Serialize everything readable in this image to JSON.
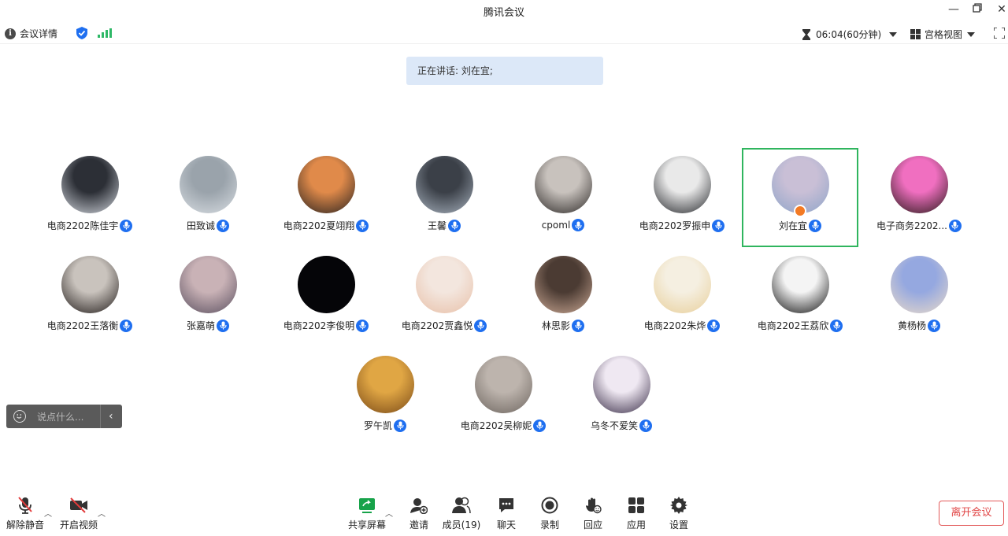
{
  "window": {
    "title": "腾讯会议"
  },
  "infobar": {
    "meeting_info_label": "会议详情",
    "timer": "06:04(60分钟)",
    "view_mode": "宫格视图"
  },
  "speaking": {
    "text": "正在讲话: 刘在宜;"
  },
  "participants": [
    {
      "name": "电商2202陈佳宇",
      "colors": [
        "#2c2f36",
        "#cfd3da"
      ]
    },
    {
      "name": "田致诚",
      "colors": [
        "#9aa3ab",
        "#d8dde2"
      ]
    },
    {
      "name": "电商2202夏翊翔",
      "colors": [
        "#e08a4a",
        "#2a2320"
      ]
    },
    {
      "name": "王馨",
      "colors": [
        "#3b4048",
        "#a6b0bc"
      ]
    },
    {
      "name": "cpoml",
      "colors": [
        "#c8c2bd",
        "#2e2a28"
      ]
    },
    {
      "name": "电商2202罗振申",
      "colors": [
        "#e9e9e9",
        "#26282c"
      ]
    },
    {
      "name": "刘在宜",
      "colors": [
        "#c9bfd6",
        "#8ea4c8"
      ]
    },
    {
      "name": "电子商务2202...",
      "colors": [
        "#f06fc0",
        "#2a1a1a"
      ]
    },
    {
      "name": "电商2202王落衡",
      "colors": [
        "#c9c3bd",
        "#231d1b"
      ]
    },
    {
      "name": "张嘉萌",
      "colors": [
        "#c9b2b6",
        "#5b5060"
      ]
    },
    {
      "name": "电商2202李俊明",
      "colors": [
        "#050508",
        "#050508"
      ]
    },
    {
      "name": "电商2202贾鑫悦",
      "colors": [
        "#f3e6de",
        "#e8c0a8"
      ]
    },
    {
      "name": "林思影",
      "colors": [
        "#4b3b33",
        "#c9a793"
      ]
    },
    {
      "name": "电商2202朱烨",
      "colors": [
        "#f5efe1",
        "#e8cf9a"
      ]
    },
    {
      "name": "电商2202王荔欣",
      "colors": [
        "#f4f4f4",
        "#111111"
      ]
    },
    {
      "name": "黄杨杨",
      "colors": [
        "#95a8e0",
        "#e8d9c9"
      ]
    },
    {
      "name": "罗午凯",
      "colors": [
        "#e0a644",
        "#7a4a18"
      ]
    },
    {
      "name": "电商2202吴柳妮",
      "colors": [
        "#bdb4ad",
        "#6d655f"
      ]
    },
    {
      "name": "乌冬不爱笑",
      "colors": [
        "#efe8f2",
        "#3a2e48"
      ]
    }
  ],
  "chat": {
    "placeholder": "说点什么..."
  },
  "toolbar": {
    "unmute": "解除静音",
    "start_video": "开启视频",
    "share_screen": "共享屏幕",
    "invite": "邀请",
    "members": "成员(19)",
    "chat": "聊天",
    "record": "录制",
    "reactions": "回应",
    "apps": "应用",
    "settings": "设置",
    "leave": "离开会议"
  },
  "colors": {
    "accent": "#1f6ff0",
    "active_border": "#2fb55e",
    "leave": "#e14545",
    "share_icon": "#17a34a"
  }
}
